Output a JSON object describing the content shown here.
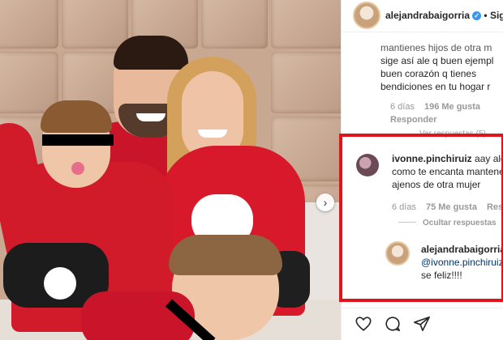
{
  "header": {
    "username": "alejandrabaigorria",
    "follow": "Sig",
    "separator": "•",
    "verified_icon": "verified-badge-icon"
  },
  "comments": {
    "first": {
      "lines": [
        "mantienes hijos de otra m",
        "sige así ale q buen ejempl",
        "buen corazón q tienes",
        "bendiciones en tu hogar r"
      ],
      "time": "6 días",
      "likes": "196 Me gusta",
      "reply": "Responder",
      "view_replies": "Ver respuestas (5)"
    },
    "second": {
      "username": "ivonne.pinchiruiz",
      "line1_rest": "aay alej",
      "lines": [
        "como te encanta mantene",
        "ajenos de otra mujer"
      ],
      "time": "6 días",
      "likes": "75 Me gusta",
      "reply": "Responder",
      "hide_replies": "Ocultar respuestas"
    },
    "reply": {
      "username": "alejandrabaigorria",
      "mention": "@ivonne.pinchiruiz",
      "text": "se feliz!!!!"
    }
  },
  "colors": {
    "highlight_border": "#e0151b",
    "verified": "#3897f0",
    "pajama_red": "#d8182b"
  },
  "icons": [
    "heart-icon",
    "comment-icon",
    "share-icon",
    "chevron-right-icon"
  ]
}
